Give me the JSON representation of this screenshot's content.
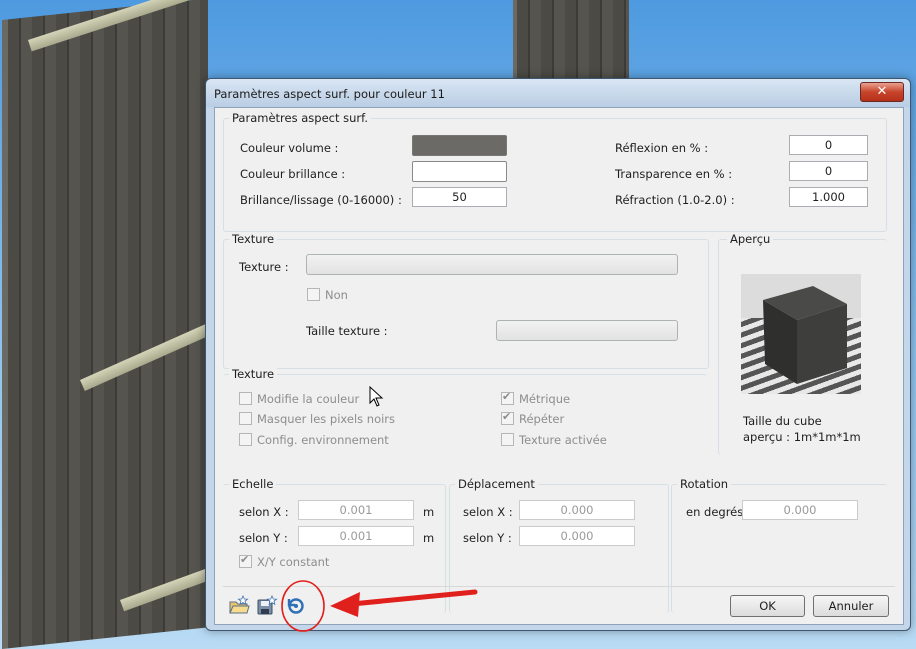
{
  "dialog": {
    "title": "Paramètres aspect surf. pour couleur  11",
    "close_symbol": "✕"
  },
  "surface": {
    "group_title": "Paramètres aspect surf.",
    "couleur_volume_label": "Couleur volume :",
    "couleur_volume_color": "#6b6a66",
    "couleur_brillance_label": "Couleur brillance :",
    "couleur_brillance_color": "#ffffff",
    "brillance_label": "Brillance/lissage (0-16000) :",
    "brillance_value": "50",
    "reflexion_label": "Réflexion en % :",
    "reflexion_value": "0",
    "transparence_label": "Transparence en % :",
    "transparence_value": "0",
    "refraction_label": "Réfraction (1.0-2.0) :",
    "refraction_value": "1.000"
  },
  "texture": {
    "group_title": "Texture",
    "texture_label": "Texture :",
    "non_label": "Non",
    "taille_label": "Taille texture :"
  },
  "texture_options": {
    "group_title": "Texture",
    "modifie_couleur": "Modifie la couleur",
    "masquer_pixels": "Masquer les pixels noirs",
    "config_env": "Config. environnement",
    "metrique": "Métrique",
    "repeter": "Répéter",
    "texture_activee": "Texture activée"
  },
  "apercu": {
    "group_title": "Aperçu",
    "caption_line1": "Taille du cube",
    "caption_line2": "aperçu : 1m*1m*1m"
  },
  "echelle": {
    "group_title": "Echelle",
    "x_label": "selon X :",
    "x_value": "0.001",
    "x_unit": "m",
    "y_label": "selon Y :",
    "y_value": "0.001",
    "y_unit": "m",
    "constant_label": "X/Y constant"
  },
  "deplacement": {
    "group_title": "Déplacement",
    "x_label": "selon X :",
    "x_value": "0.000",
    "y_label": "selon Y :",
    "y_value": "0.000"
  },
  "rotation": {
    "group_title": "Rotation",
    "label": "en degrés",
    "value": "0.000"
  },
  "buttons": {
    "ok": "OK",
    "cancel": "Annuler"
  },
  "toolbar_icons": [
    "open-favorites-icon",
    "save-favorites-icon",
    "reset-icon"
  ],
  "colors": {
    "annotation_red": "#e0201c"
  }
}
